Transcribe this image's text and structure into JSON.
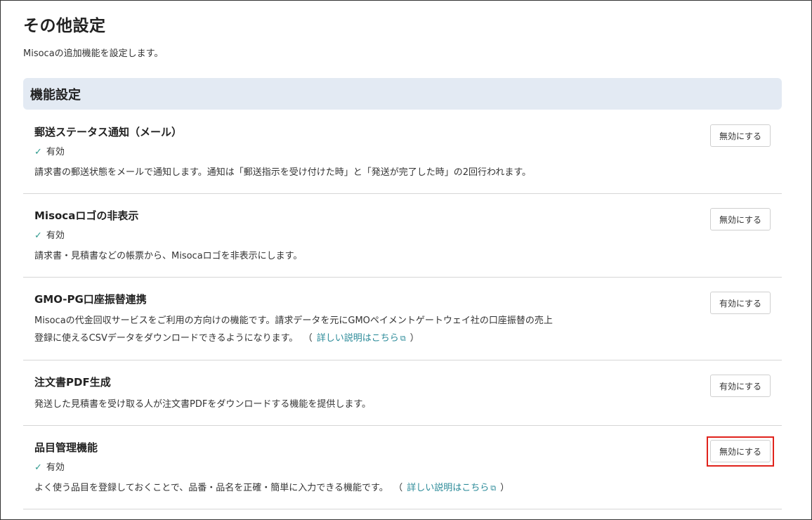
{
  "page": {
    "title": "その他設定",
    "description": "Misocaの追加機能を設定します。"
  },
  "section": {
    "title": "機能設定"
  },
  "features": [
    {
      "title": "郵送ステータス通知（メール）",
      "status": "有効",
      "description": "請求書の郵送状態をメールで通知します。通知は「郵送指示を受け付けた時」と「発送が完了した時」の2回行われます。",
      "button_label": "無効にする"
    },
    {
      "title": "Misocaロゴの非表示",
      "status": "有効",
      "description": "請求書・見積書などの帳票から、Misocaロゴを非表示にします。",
      "button_label": "無効にする"
    },
    {
      "title": "GMO-PG口座振替連携",
      "description_line1": "Misocaの代金回収サービスをご利用の方向けの機能です。請求データを元にGMOペイメントゲートウェイ社の口座振替の売上",
      "description_line2": "登録に使えるCSVデータをダウンロードできるようになります。",
      "paren_open": "（",
      "link_label": "詳しい説明はこちら",
      "paren_close": "）",
      "button_label": "有効にする"
    },
    {
      "title": "注文書PDF生成",
      "description": "発送した見積書を受け取る人が注文書PDFをダウンロードする機能を提供します。",
      "button_label": "有効にする"
    },
    {
      "title": "品目管理機能",
      "status": "有効",
      "description": "よく使う品目を登録しておくことで、品番・品名を正確・簡単に入力できる機能です。",
      "paren_open": "（",
      "link_label": "詳しい説明はこちら",
      "paren_close": "）",
      "button_label": "無効にする"
    }
  ],
  "icons": {
    "check": "check-icon",
    "external_link": "external-link-icon"
  },
  "colors": {
    "section_header_bg": "#e3eaf3",
    "accent_link": "#2a8a98",
    "check": "#2f9a8e",
    "highlight": "#e0231c"
  }
}
